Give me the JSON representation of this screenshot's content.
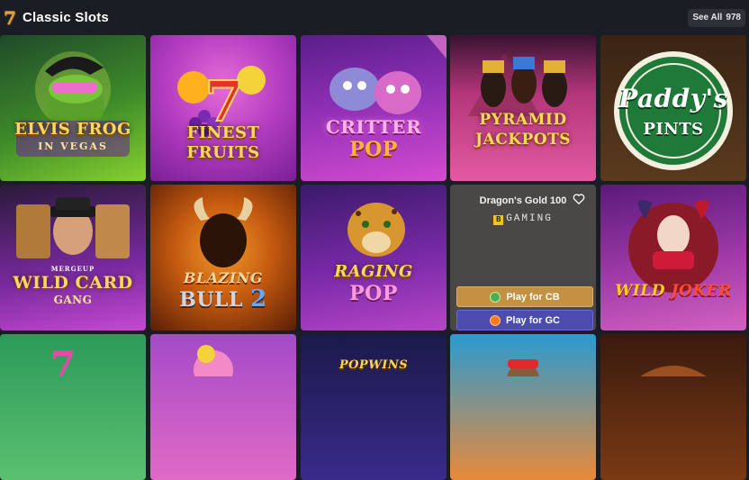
{
  "header": {
    "logo_glyph": "7",
    "title": "Classic Slots",
    "see_all_label": "See All",
    "see_all_count": "978"
  },
  "tiles": [
    {
      "name_line1": "ELVIS FROG",
      "name_line2": "IN VEGAS"
    },
    {
      "name_line1": "FINEST",
      "name_line2": "FRUITS"
    },
    {
      "name_line1": "CRITTER",
      "name_line2": "POP"
    },
    {
      "name_line1": "PYRAMID",
      "name_line2": "JACKPOTS"
    },
    {
      "name_line1": "Paddy's",
      "name_line2": "PINTS"
    },
    {
      "name_line1": "WILD CARD",
      "name_line2": "GANG",
      "tag": "MERGEUP"
    },
    {
      "name_line1": "BLAZING",
      "name_line2": "BULL",
      "suffix": "2"
    },
    {
      "name_line1": "RAGING",
      "name_line2": "POP"
    },
    {
      "hover": true,
      "title": "Dragon's Gold 100",
      "provider_badge": "B",
      "provider": "GAMING",
      "play_cb_label": "Play for CB",
      "play_gc_label": "Play for GC"
    },
    {
      "name_line1": "WILD",
      "name_line2": "JOKER"
    },
    {
      "name_line1": "",
      "name_line2": ""
    },
    {
      "name_line1": "",
      "name_line2": ""
    },
    {
      "name_line1": "POPWINS",
      "name_line2": ""
    },
    {
      "name_line1": "",
      "name_line2": ""
    },
    {
      "name_line1": "",
      "name_line2": ""
    }
  ],
  "colors": {
    "background": "#1b1d24",
    "play_cb": "#c49043",
    "play_gc": "#4b4bb0",
    "hover_card": "#4a4747"
  }
}
